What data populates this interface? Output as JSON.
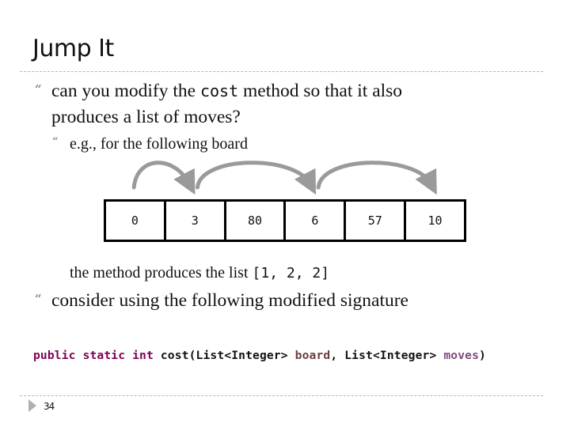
{
  "slide": {
    "title": "Jump It",
    "page_number": "34",
    "bullet_glyph": "“",
    "bullets": [
      {
        "line1_prefix": "can you modify the ",
        "line1_code": "cost",
        "line1_suffix": " method so that it also",
        "line2": "produces a list of moves?",
        "sub": "e.g., for the following board"
      }
    ],
    "board": {
      "cells": [
        "0",
        "3",
        "80",
        "6",
        "57",
        "10"
      ],
      "jumps": [
        {
          "from": 0,
          "to": 1
        },
        {
          "from": 1,
          "to": 3
        },
        {
          "from": 3,
          "to": 5
        }
      ]
    },
    "result": {
      "prefix": "the method produces the list ",
      "code": "[1, 2, 2]"
    },
    "bullet2": "consider using the following modified signature",
    "signature": {
      "kw_public": "public",
      "kw_static": "static",
      "kw_int": "int",
      "method": "cost(List<Integer>",
      "param1": "board",
      "comma_type": ", List<Integer>",
      "param2": "moves",
      "close": ")"
    },
    "colors": {
      "keyword": "#7f0055",
      "param_board": "#6a3e3e",
      "param_moves": "#7e4b7e",
      "arrow": "#9a9a9a"
    }
  }
}
